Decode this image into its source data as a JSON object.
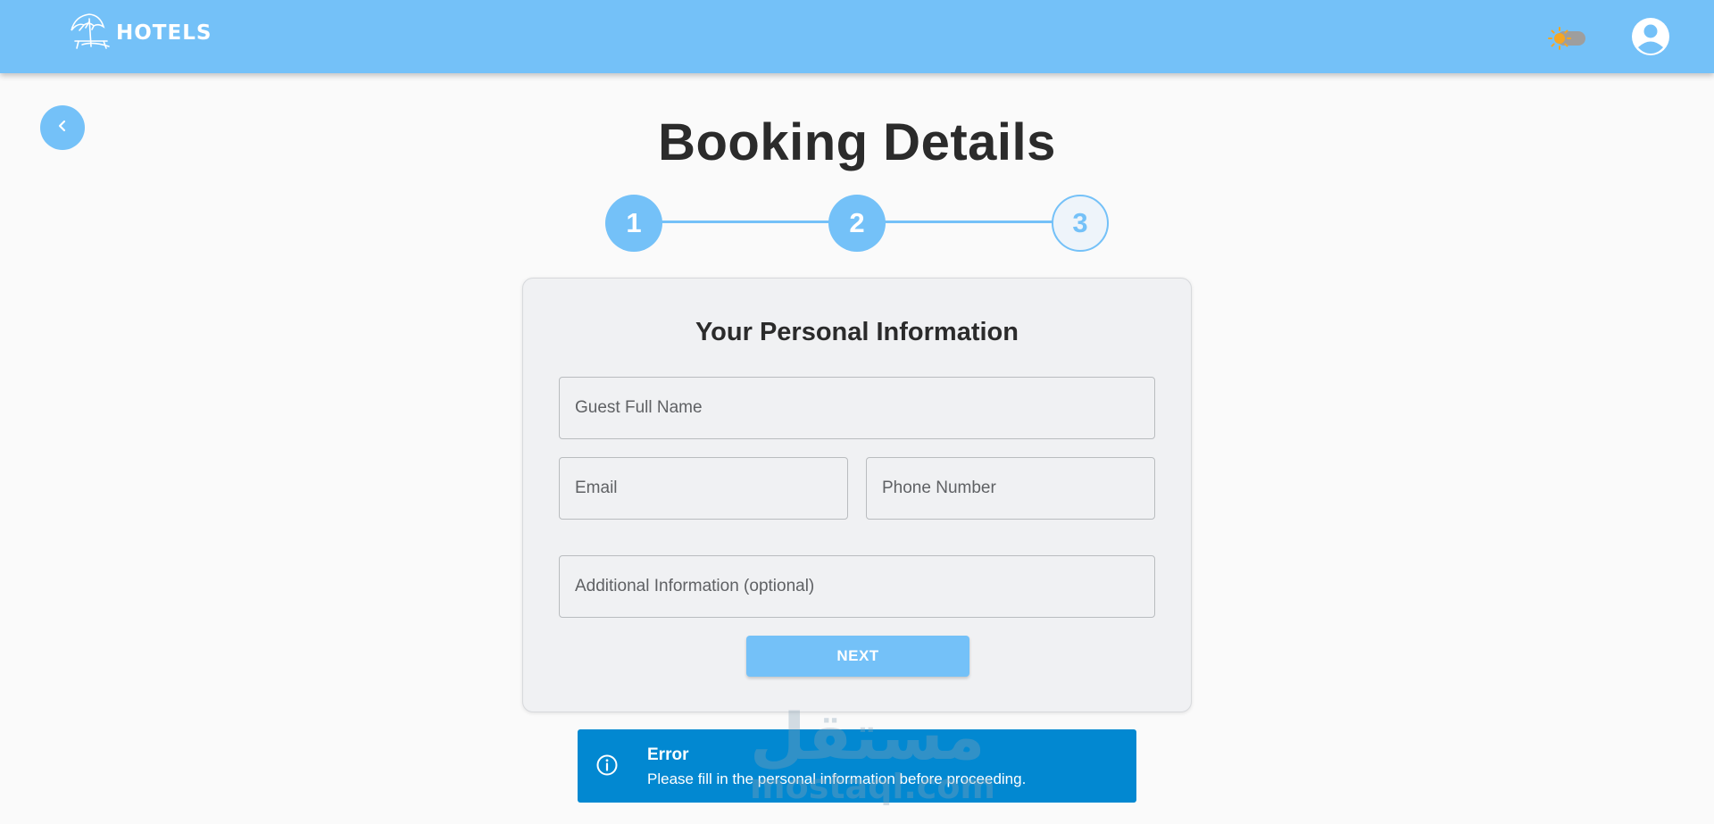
{
  "header": {
    "brand": "HOTELS",
    "logo_icon": "beach-umbrella-icon",
    "theme_toggle_icon": "sun-icon",
    "profile_icon": "account-circle-icon"
  },
  "nav": {
    "back_icon": "chevron-left-icon"
  },
  "page": {
    "title": "Booking Details"
  },
  "stepper": {
    "active_step": 3,
    "steps": [
      {
        "label": "1",
        "state": "completed"
      },
      {
        "label": "2",
        "state": "completed"
      },
      {
        "label": "3",
        "state": "current"
      }
    ]
  },
  "form": {
    "title": "Your Personal Information",
    "fields": {
      "full_name": {
        "placeholder": "Guest Full Name",
        "value": ""
      },
      "email": {
        "placeholder": "Email",
        "value": ""
      },
      "phone": {
        "placeholder": "Phone Number",
        "value": ""
      },
      "additional": {
        "placeholder": "Additional Information (optional)",
        "value": ""
      }
    },
    "next_label": "NEXT"
  },
  "alert": {
    "icon": "info-icon",
    "title": "Error",
    "message": "Please fill in the personal information before proceeding."
  },
  "watermark": {
    "arabic": "مستقل",
    "latin": "mostaql.com"
  },
  "colors": {
    "primary": "#74c1f8",
    "alert_bg": "#0288d1",
    "page_bg": "#fafafa",
    "card_bg": "#f0f1f3",
    "sun": "#f5a623",
    "text": "#2b2b2b"
  }
}
